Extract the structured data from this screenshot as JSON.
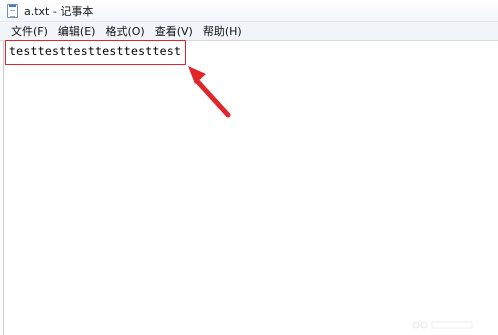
{
  "window": {
    "title": "a.txt - 记事本",
    "icon": "notepad-icon"
  },
  "menu": {
    "items": [
      {
        "id": "file",
        "label": "文件(F)"
      },
      {
        "id": "edit",
        "label": "编辑(E)"
      },
      {
        "id": "format",
        "label": "格式(O)"
      },
      {
        "id": "view",
        "label": "查看(V)"
      },
      {
        "id": "help",
        "label": "帮助(H)"
      }
    ]
  },
  "editor": {
    "content": "testtesttesttesttesttest"
  },
  "annotation": {
    "box_color": "#e0262a",
    "arrow_color": "#e0262a",
    "arrow_icon": "red-arrow-pointer"
  }
}
